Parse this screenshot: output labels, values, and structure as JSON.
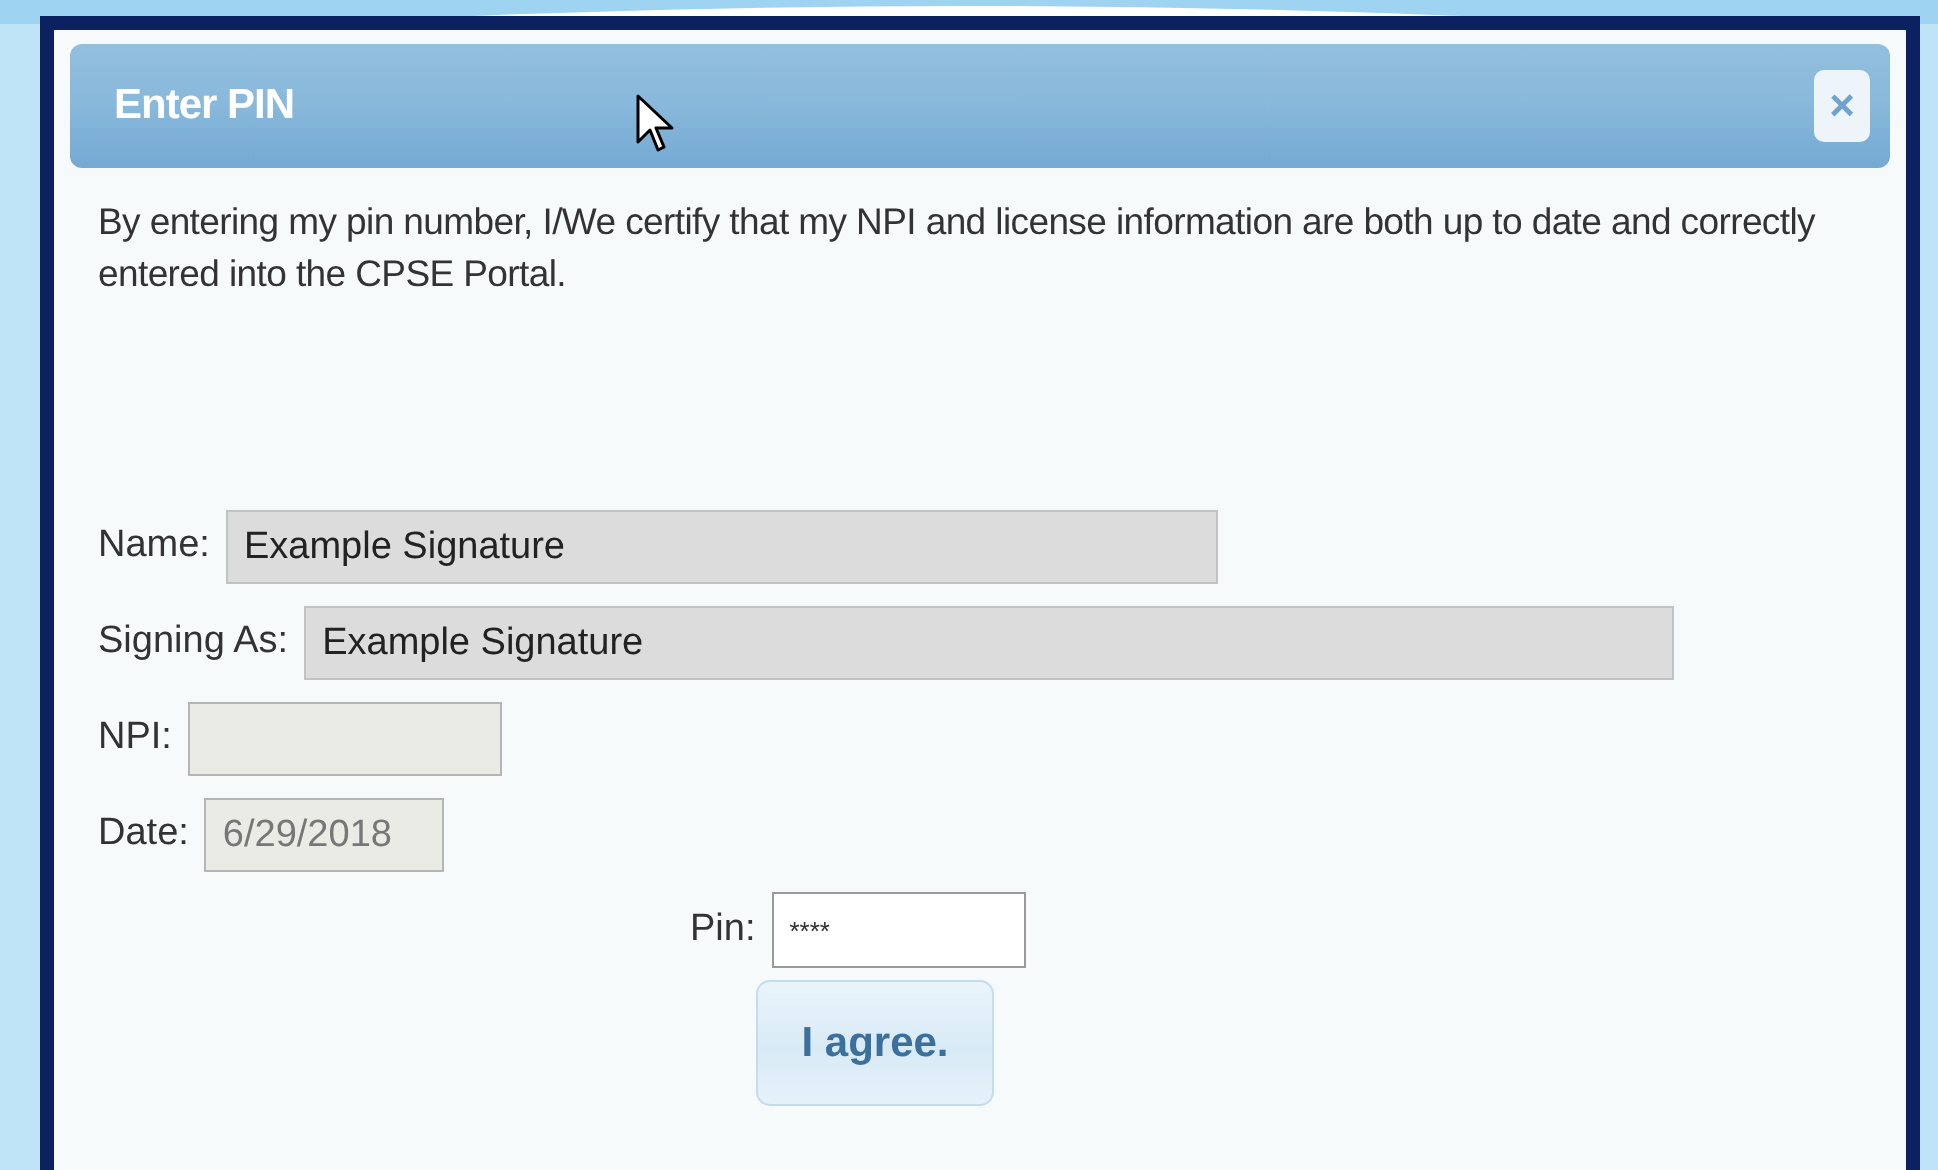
{
  "dialog": {
    "title": "Enter PIN",
    "close_label": "×",
    "message": "By entering my pin number, I/We certify that my NPI and license information are both up to date and correctly entered into the CPSE Portal.",
    "fields": [
      {
        "label": "Name:",
        "value": "Example Signature",
        "disabled": false
      },
      {
        "label": "Signing As:",
        "value": "Example Signature",
        "disabled": false
      },
      {
        "label": "NPI:",
        "disabled": true
      },
      {
        "label": "Date:",
        "value": "6/29/2018",
        "disabled": true
      }
    ],
    "pin": {
      "label": "Pin:",
      "value": "****"
    },
    "button": "I agree."
  }
}
